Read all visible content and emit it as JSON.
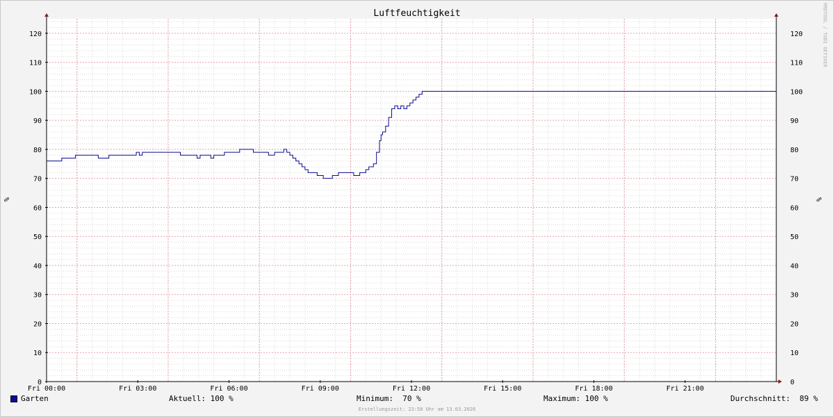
{
  "chart_data": {
    "type": "line",
    "title": "Luftfeuchtigkeit",
    "ylabel": "%",
    "ylim": [
      0,
      125
    ],
    "yticks": [
      0,
      10,
      20,
      30,
      40,
      50,
      60,
      70,
      80,
      90,
      100,
      110,
      120
    ],
    "xlim": [
      0,
      24
    ],
    "xticks": [
      {
        "hour": 0,
        "label": "Fri 00:00"
      },
      {
        "hour": 3,
        "label": "Fri 03:00"
      },
      {
        "hour": 6,
        "label": "Fri 06:00"
      },
      {
        "hour": 9,
        "label": "Fri 09:00"
      },
      {
        "hour": 12,
        "label": "Fri 12:00"
      },
      {
        "hour": 15,
        "label": "Fri 15:00"
      },
      {
        "hour": 18,
        "label": "Fri 18:00"
      },
      {
        "hour": 21,
        "label": "Fri 21:00"
      }
    ],
    "grid": true,
    "series": [
      {
        "name": "Garten",
        "color": "#0a0a8c",
        "x": [
          0,
          0.15,
          0.5,
          0.95,
          1.7,
          2.05,
          2.95,
          3.05,
          3.15,
          4.4,
          4.95,
          5.05,
          5.4,
          5.5,
          5.85,
          6.35,
          6.8,
          7.3,
          7.5,
          7.8,
          7.9,
          8.0,
          8.1,
          8.2,
          8.3,
          8.4,
          8.5,
          8.6,
          8.9,
          9.1,
          9.15,
          9.2,
          9.4,
          9.6,
          9.85,
          10.1,
          10.3,
          10.5,
          10.6,
          10.75,
          10.85,
          10.95,
          11.0,
          11.05,
          11.15,
          11.25,
          11.35,
          11.45,
          11.55,
          11.65,
          11.75,
          11.85,
          11.95,
          12.05,
          12.15,
          12.25,
          12.35,
          12.45,
          24
        ],
        "values": [
          76,
          76,
          77,
          78,
          77,
          78,
          79,
          78,
          79,
          78,
          77,
          78,
          77,
          78,
          79,
          80,
          79,
          78,
          79,
          80,
          79,
          78,
          77,
          76,
          75,
          74,
          73,
          72,
          71,
          70,
          70,
          70,
          71,
          72,
          72,
          71,
          72,
          73,
          74,
          75,
          79,
          83,
          85,
          86,
          88,
          91,
          94,
          95,
          94,
          95,
          94,
          95,
          96,
          97,
          98,
          99,
          100,
          100,
          100
        ]
      }
    ]
  },
  "legend": {
    "series_name": "Garten",
    "aktuell": "Aktuell: 100 %",
    "minimum": "Minimum:  70 %",
    "maximum": "Maximum: 100 %",
    "durchschnitt": "Durchschnitt:  89 %"
  },
  "footer": {
    "credit": "Erstellungszeit: 23:58 Uhr am 13.03.2026",
    "watermark": "RRDTOOL / TOBI OETIKER"
  }
}
